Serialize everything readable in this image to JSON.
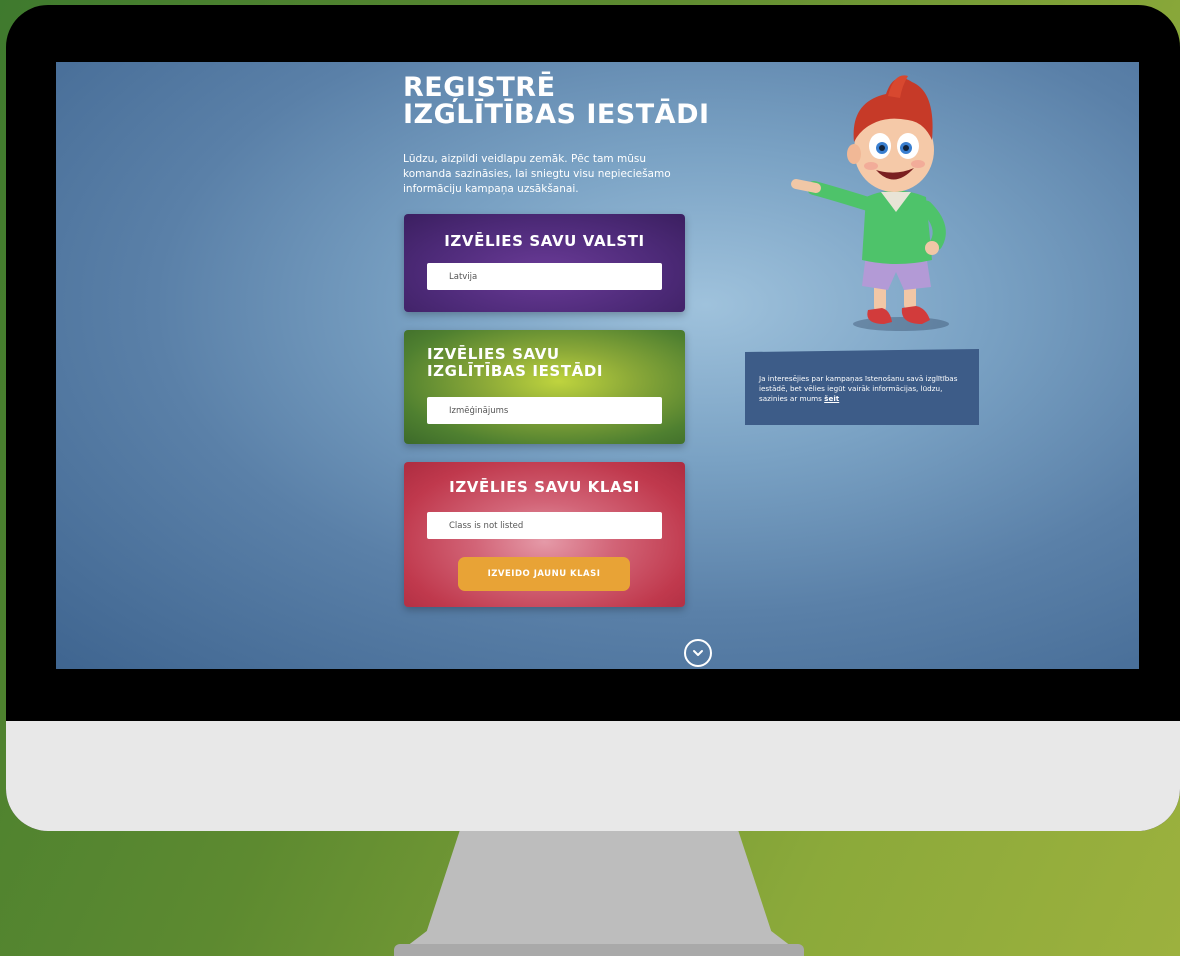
{
  "page": {
    "title_line1": "REĢISTRĒ",
    "title_line2": "IZGLĪTĪBAS IESTĀDI",
    "intro": "Lūdzu, aizpildi veidlapu zemāk. Pēc tam mūsu komanda sazināsies, lai sniegtu visu nepieciešamo informāciju kampaņa uzsākšanai."
  },
  "country_card": {
    "title": "IZVĒLIES SAVU VALSTI",
    "value": "Latvija"
  },
  "school_card": {
    "title": "IZVĒLIES SAVU IZGLĪTĪBAS IESTĀDI",
    "value": "Izmēģinājums"
  },
  "class_card": {
    "title": "IZVĒLIES SAVU KLASI",
    "value": "Class is not listed",
    "button_label": "IZVEIDO JAUNU KLASI"
  },
  "info_box": {
    "text": "Ja interesējies par kampaņas īstenošanu savā izglītības iestādē, bet vēlies iegūt vairāk informācijas, lūdzu, sazinies ar mums",
    "link_label": "šeit"
  },
  "icons": {
    "scroll_down": "chevron-down-icon",
    "mascot": "cartoon-boy-mascot"
  },
  "colors": {
    "background_green": "#5d8a30",
    "screen_blue": "#5a80a8",
    "country_purple": "#4d2a78",
    "school_green": "#8aa838",
    "class_red": "#c0394d",
    "button_orange": "#e8a336",
    "info_blue": "#3d5c88"
  }
}
